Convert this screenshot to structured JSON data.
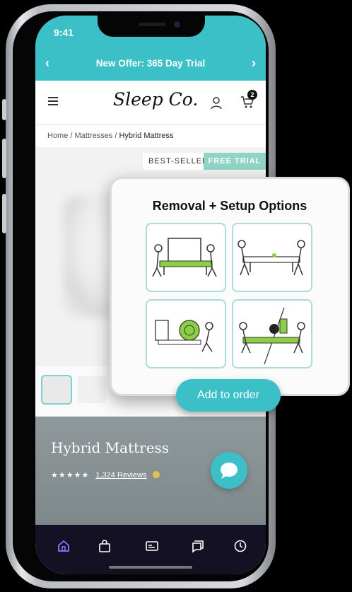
{
  "status_bar": {
    "time": "9:41"
  },
  "offer_bar": {
    "text": "New Offer: 365 Day Trial",
    "prev_icon": "chevron-left-icon",
    "next_icon": "chevron-right-icon"
  },
  "header": {
    "logo": "Sleep Co.",
    "cart_count": "2",
    "menu_icon": "hamburger-menu-icon",
    "account_icon": "user-icon",
    "cart_icon": "cart-icon"
  },
  "breadcrumb": {
    "items": [
      "Home",
      "Mattresses"
    ],
    "current": "Hybrid Mattress"
  },
  "badges": {
    "best_seller": "BEST-SELLER",
    "free_trial": "FREE TRIAL"
  },
  "product": {
    "title": "Hybrid Mattress",
    "rating_stars": 4.5,
    "stars": "★★★★★",
    "reviews": "1,324 Reviews"
  },
  "popup": {
    "title": "Removal + Setup Options",
    "options": [
      "removal-illustration",
      "unboxing-illustration",
      "recycling-illustration",
      "swap-illustration"
    ],
    "button": "Add to order"
  },
  "bottom_nav": {
    "items": [
      "home-icon",
      "bag-icon",
      "card-icon",
      "messages-icon",
      "clock-icon"
    ]
  },
  "colors": {
    "accent": "#3cc0c7",
    "free_trial": "#8fd4c7",
    "nav_bg": "#141125",
    "active_nav": "#8a79ff"
  }
}
